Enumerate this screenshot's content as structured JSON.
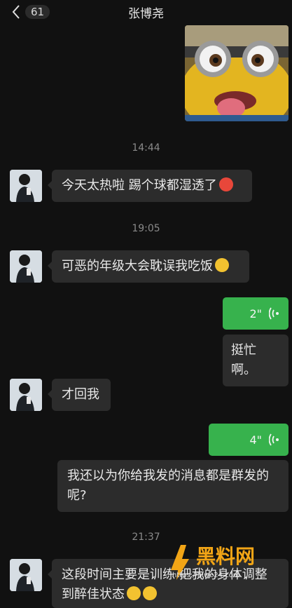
{
  "header": {
    "back_count": "61",
    "title": "张博尧"
  },
  "messages": {
    "time1": "14:44",
    "msg1": "今天太热啦 踢个球都湿透了",
    "time2": "19:05",
    "msg2": "可恶的年级大会耽误我吃饭",
    "voice1": "2\"",
    "msg3": "挺忙啊。",
    "msg4": "才回我",
    "voice2": "4\"",
    "msg5": "我还以为你给我发的消息都是群发的呢?",
    "time3": "21:37",
    "msg6": "这段时间主要是训练 把我的身体调整到醉佳状态"
  },
  "watermark": {
    "brand": "黑料网",
    "url": "https://hlwe24.com"
  },
  "colors": {
    "voice_bubble": "#37b24d",
    "bubble": "#2c2c2c",
    "background": "#111111"
  }
}
